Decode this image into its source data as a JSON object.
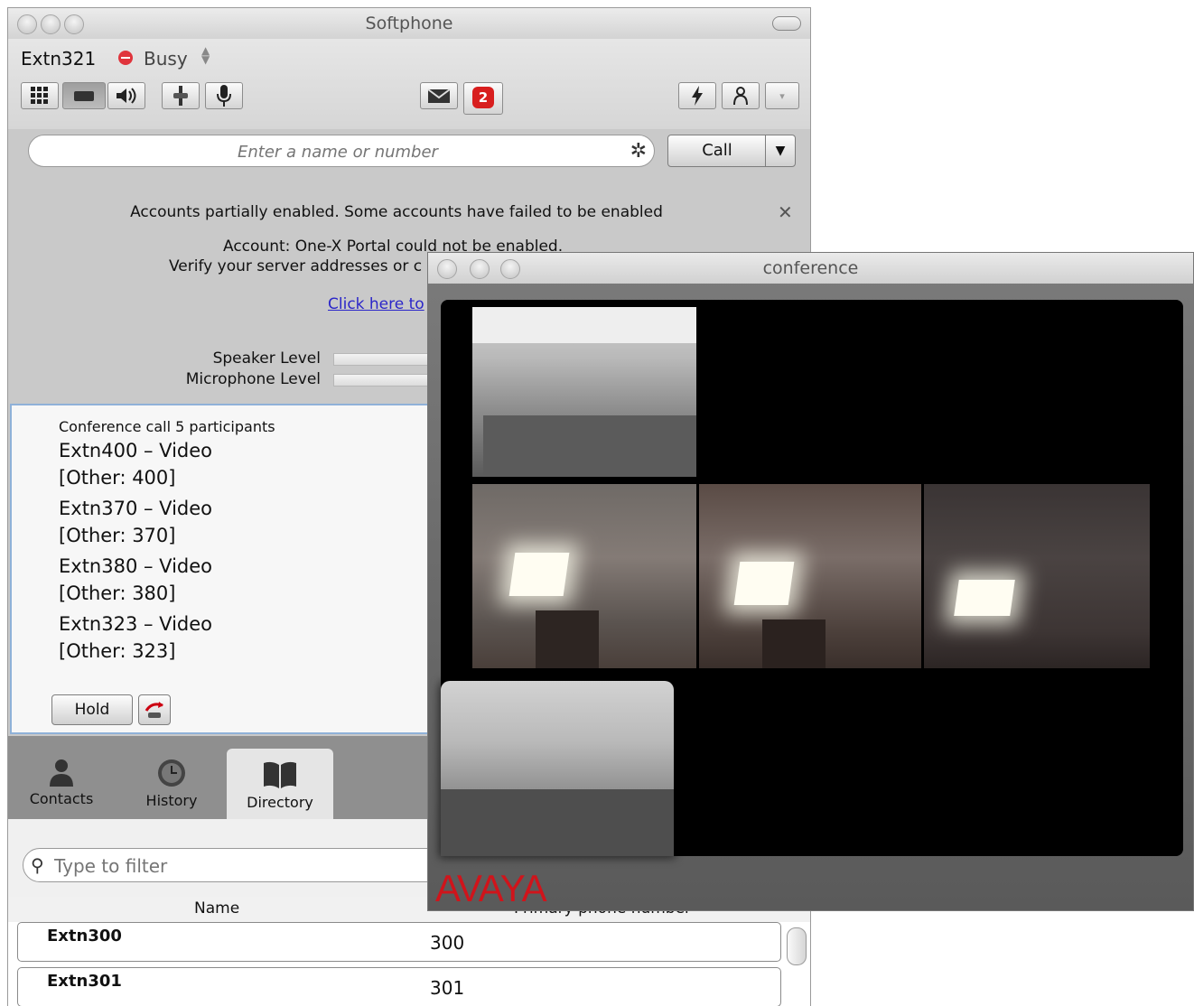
{
  "softphone": {
    "title": "Softphone",
    "account": "Extn321",
    "status": "Busy",
    "search_placeholder": "Enter a name or number",
    "call_label": "Call",
    "voicemail_count": "2",
    "notice": {
      "line1": "Accounts partially enabled. Some accounts have failed to be enabled",
      "line2": "Account: One-X Portal could not be enabled.",
      "line3": "Verify your server addresses or c",
      "link": "Click here to"
    },
    "levels": {
      "speaker_label": "Speaker Level",
      "microphone_label": "Microphone Level"
    },
    "call_panel": {
      "header": "Conference call 5 participants",
      "participants": [
        {
          "name": "Extn400 – Video",
          "other": "[Other: 400]"
        },
        {
          "name": "Extn370 – Video",
          "other": "[Other: 370]"
        },
        {
          "name": "Extn380 – Video",
          "other": "[Other: 380]"
        },
        {
          "name": "Extn323 – Video",
          "other": "[Other: 323]"
        }
      ],
      "hold_label": "Hold"
    },
    "tabs": [
      {
        "label": "Contacts",
        "icon": "person-icon"
      },
      {
        "label": "History",
        "icon": "clock-icon"
      },
      {
        "label": "Directory",
        "icon": "book-icon",
        "selected": true
      }
    ],
    "filter_placeholder": "Type to filter",
    "directory": {
      "columns": [
        "Name",
        "Primary phone number"
      ],
      "rows": [
        {
          "name": "Extn300",
          "number": "300"
        },
        {
          "name": "Extn301",
          "number": "301"
        }
      ]
    }
  },
  "conference": {
    "title": "conference",
    "logo": "AVAYA"
  }
}
